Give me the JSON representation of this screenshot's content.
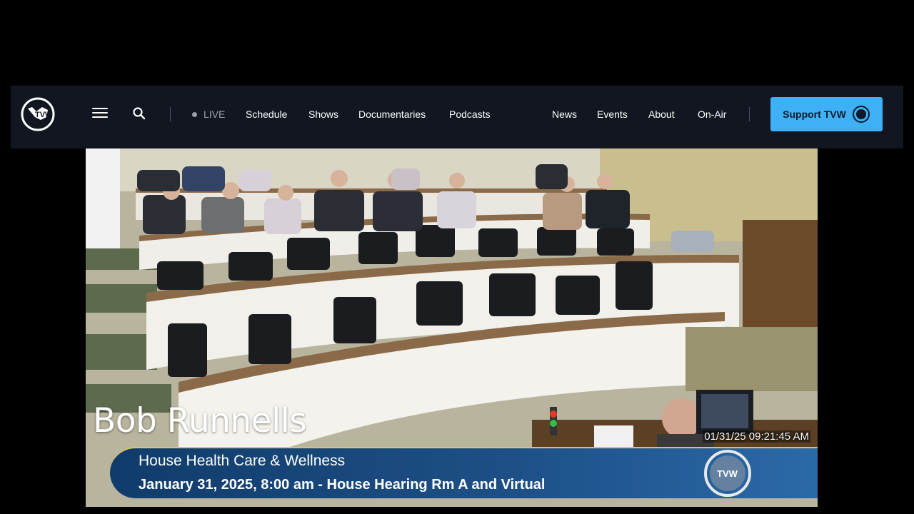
{
  "nav": {
    "logo_text": "TVW",
    "live": "LIVE",
    "items": [
      "Schedule",
      "Shows",
      "Documentaries",
      "Podcasts"
    ],
    "right_items": [
      "News",
      "Events",
      "About",
      "On-Air"
    ],
    "support_label": "Support TVW"
  },
  "video": {
    "speaker_name": "Bob Runnells",
    "timestamp": "01/31/25 09:21:45 AM",
    "banner_title": "House Health Care & Wellness",
    "banner_subtitle": "January 31, 2025, 8:00 am - House Hearing Rm A and Virtual",
    "banner_logo_text": "TVW"
  },
  "colors": {
    "nav_bg": "#111621",
    "support_bg": "#3fb0f5",
    "banner_bg": "#1d4f86",
    "banner_rule": "#d9c46a"
  },
  "icons": [
    "tvw-logo-icon",
    "hamburger-menu-icon",
    "search-icon",
    "tvw-badge-icon"
  ]
}
